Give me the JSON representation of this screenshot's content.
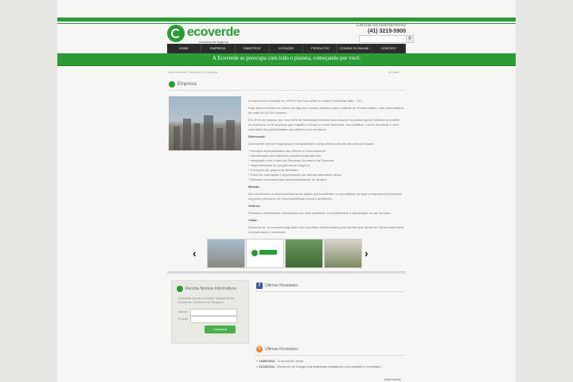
{
  "header": {
    "logo_text": "ecoverde",
    "logo_subtitle": "corretora de seguros",
    "contact_label": "Central de Atendimento",
    "phone": "(41) 3219-5900",
    "search_icon": "magnifier-icon"
  },
  "nav": {
    "items": [
      "HOME",
      "EMPRESA",
      "SINISTROS",
      "COTAÇÃO",
      "PRODUTOS",
      "CONSULTA ONLINE",
      "CONTATO"
    ]
  },
  "banner": {
    "text": "A Ecoverde se preocupa com todo o planeta, começando por você."
  },
  "breadcrumb": "Você está em: Empresa > Empresa",
  "voltar": "Voltar",
  "section_title": "Empresa",
  "content": {
    "p1": "A empresa foi fundada em 1978 e tem sua sede no Centro Comercial Itália - CCI.",
    "p2": "Hoje atua em todos os ramos de seguros e presta serviços para o estado do Paraná inteiro, com uma carteira de mais de 15.000 clientes.",
    "p3": "Em 2010 ela passou por uma série de mudanças internas para assumir a postura que já adotava no âmbito do consumo, a de empresa que respeita o futuro e o meio ambiente. Isso justifica o nome Ecoverde e abre uma série de possibilidades aos clientes e funcionários.",
    "diferencial_title": "Diferencial:",
    "diferencial_text": "A Ecoverde oferece segurança e tranquilidade a seus clientes através de seus princípios:",
    "bullets": [
      "* Serviços especializados aos clientes e consumidores.",
      "* Identificação dos melhores parceiros seguradores.",
      "* Integração com a área de Recursos Humanos da Empresa.",
      "* Implementação de programas de seguros.",
      "* Formação de grupos de afinidade.",
      "* Posto de orientação e regularização de clientes altamente eficaz.",
      "* Estrutura exclusiva para acompanhamento de sinistro."
    ],
    "missao_title": "Missão:",
    "missao_text": "Ser excelência no desenvolvimento de ações que beneficiem a comunidade na qual a empresa está inserida, seguindo princípios de responsabilidade social e ambiental.",
    "valores_title": "Valores:",
    "valores_text": "Princípios norteadores relacionados ao meio ambiente, a contabilidade e valorização do ser humano.",
    "visao_title": "Visão:",
    "visao_text": "Destacar-se no mercado segurador com produtos diferenciados para clientes que atuam de forma sustentável e preservando o ambiente."
  },
  "carousel": {
    "prev": "‹",
    "next": "›"
  },
  "newsletter": {
    "title": "Receba Nossos Informativos",
    "desc": "Cadastre-se para receber novidades da Ecoverde Corretora de Seguros:",
    "name_label": "Nome:",
    "email_label": "E-mail:",
    "button": "Cadastrar"
  },
  "facebook": {
    "title": "Últimas Novidades"
  },
  "blog": {
    "title": "Últimas Novidades",
    "items": [
      {
        "date": "14/09/2012",
        "text": "- O ecoverde Verde"
      },
      {
        "date": "11/10/2011",
        "text": "- Escritório de Design cria luminárias fantásticas com papelão e é exemplo..."
      }
    ],
    "ver_todas": "[veja todas]"
  }
}
